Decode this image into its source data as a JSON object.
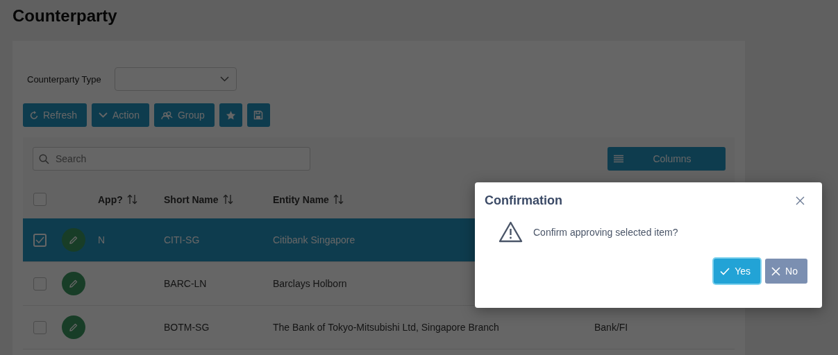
{
  "page": {
    "title": "Counterparty"
  },
  "filter": {
    "label": "Counterparty Type"
  },
  "toolbar": {
    "buttons": [
      "Refresh",
      "Action",
      "Group"
    ]
  },
  "grid": {
    "search": {
      "placeholder": "Search"
    },
    "columns_button": "Columns",
    "all_checked": false,
    "columns": [
      "App?",
      "Short Name",
      "Entity Name"
    ],
    "rows": [
      {
        "selected": true,
        "app": "N",
        "short_name": "CITI-SG",
        "entity_name": "Citibank Singapore"
      },
      {
        "selected": false,
        "short_name": "BARC-LN",
        "entity_name": "Barclays Holborn"
      },
      {
        "selected": false,
        "short_name": "BOTM-SG",
        "entity_name": "The Bank of Tokyo-Mitsubishi Ltd, Singapore Branch",
        "column_4": "Bank/FI"
      }
    ]
  },
  "dialog": {
    "title": "Confirmation",
    "message": "Confirm approving selected item?",
    "buttons": [
      {
        "kind": "confirm",
        "label": "Yes",
        "focused": true
      },
      {
        "kind": "cancel",
        "label": "No",
        "focused": false
      }
    ]
  }
}
